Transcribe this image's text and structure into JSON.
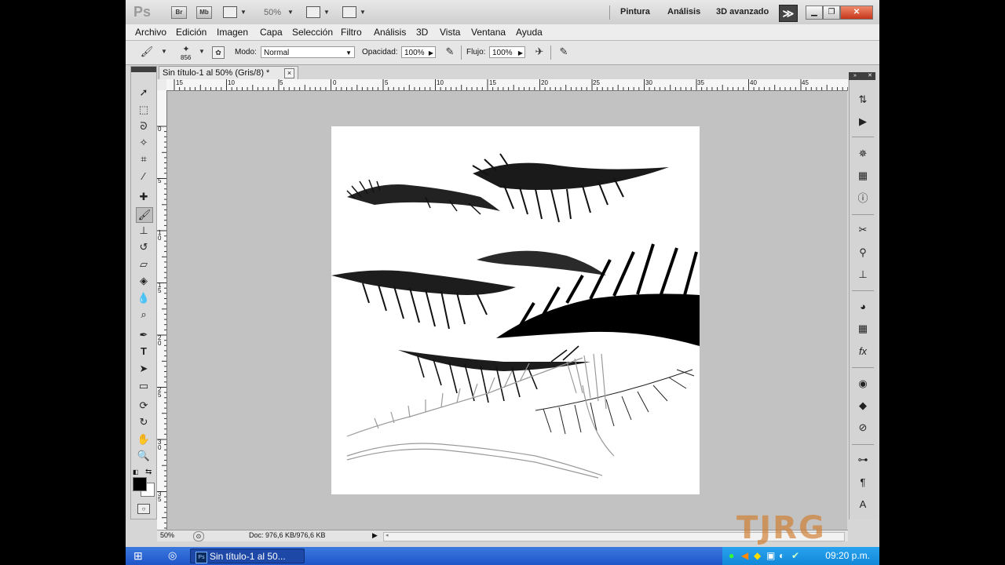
{
  "app": {
    "logo": "Ps",
    "bridge_label": "Br",
    "minibridge_label": "Mb",
    "zoom_display": "50%",
    "workspaces": [
      "Pintura",
      "Análisis",
      "3D avanzado"
    ],
    "more_label": "≫"
  },
  "menu": [
    "Archivo",
    "Edición",
    "Imagen",
    "Capa",
    "Selección",
    "Filtro",
    "Análisis",
    "3D",
    "Vista",
    "Ventana",
    "Ayuda"
  ],
  "options": {
    "brush_size": "856",
    "mode_label": "Modo:",
    "mode_value": "Normal",
    "opacity_label": "Opacidad:",
    "opacity_value": "100%",
    "flow_label": "Flujo:",
    "flow_value": "100%"
  },
  "document": {
    "tab_title": "Sin título-1 al 50% (Gris/8) *",
    "close_glyph": "×"
  },
  "ruler_top": [
    "15",
    "10",
    "5",
    "0",
    "5",
    "10",
    "15",
    "20",
    "25",
    "30",
    "35",
    "40",
    "45"
  ],
  "ruler_left": [
    "0",
    "5",
    "1\n0",
    "1\n5",
    "2\n0",
    "2\n5",
    "3\n0",
    "3\n5"
  ],
  "status": {
    "zoom": "50%",
    "doc_info": "Doc: 976,6 KB/976,6 KB"
  },
  "taskbar": {
    "task_label": "Sin título-1 al 50...",
    "time": "09:20 p.m."
  },
  "watermark": "TJRG",
  "colors": {
    "foreground": "#000000",
    "background": "#ffffff",
    "taskbar": "#245edb"
  }
}
